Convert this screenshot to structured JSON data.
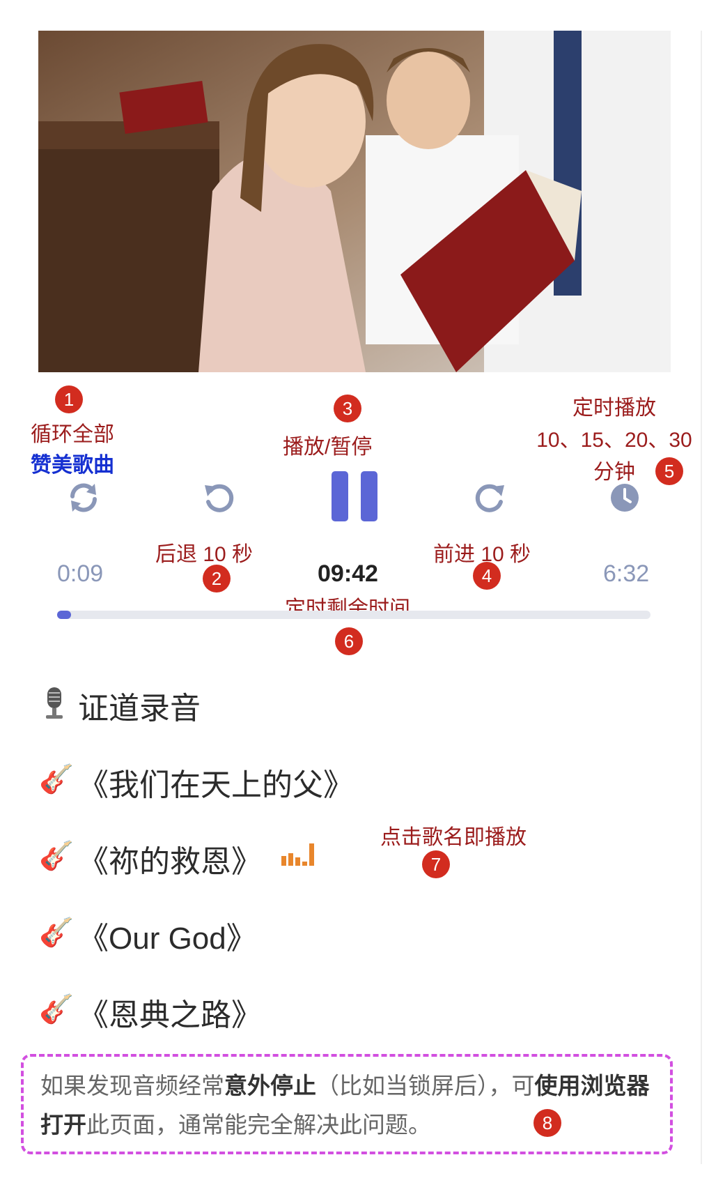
{
  "annotations": {
    "loop": {
      "num": "1",
      "line1": "循环全部",
      "line2": "赞美歌曲"
    },
    "back10": {
      "num": "2",
      "text": "后退 10 秒"
    },
    "playpause": {
      "num": "3",
      "text": "播放/暂停"
    },
    "forward10": {
      "num": "4",
      "text": "前进 10 秒"
    },
    "timer": {
      "num": "5",
      "line1": "定时播放",
      "line2": "10、15、20、30",
      "line3": "分钟"
    },
    "remaining": {
      "num": "6",
      "text": "定时剩余时间"
    },
    "tapsong": {
      "num": "7",
      "text": "点击歌名即播放"
    },
    "notice": {
      "num": "8"
    }
  },
  "player": {
    "elapsed": "0:09",
    "timer_remaining": "09:42",
    "duration": "6:32",
    "progress_fraction": 0.023,
    "accent_color": "#5b66d6",
    "icons": [
      "repeat-icon",
      "rewind-10-icon",
      "pause-icon",
      "forward-10-icon",
      "clock-icon"
    ]
  },
  "sermon": {
    "icon": "microphone-icon",
    "label": "证道录音"
  },
  "songs": [
    {
      "icon": "guitar-icon",
      "title": "《我们在天上的父》",
      "playing": false
    },
    {
      "icon": "guitar-icon",
      "title": "《祢的救恩》",
      "playing": true
    },
    {
      "icon": "guitar-icon",
      "title": "《Our God》",
      "playing": false
    },
    {
      "icon": "guitar-icon",
      "title": "《恩典之路》",
      "playing": false
    }
  ],
  "notice": {
    "p1": "如果发现音频经常",
    "b1": "意外停止",
    "p2": "（比如当锁屏后），可",
    "b2": "使用浏览器打开",
    "p3": "此页面，通常能完全解决此问题。"
  }
}
